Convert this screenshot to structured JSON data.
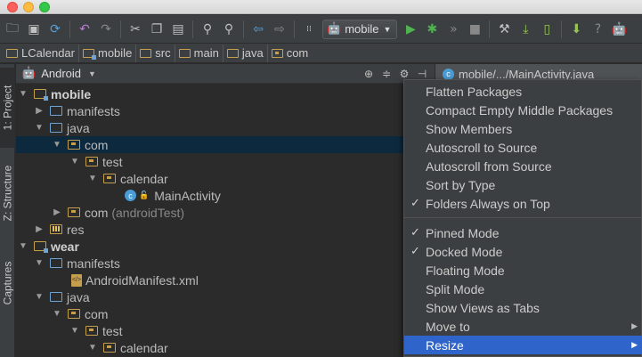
{
  "window": {
    "controls": [
      "close",
      "minimize",
      "zoom"
    ]
  },
  "toolbar": {
    "run_config": "mobile",
    "icons": [
      "open-folder-icon",
      "save-icon",
      "sync-icon",
      "undo-icon",
      "redo-icon",
      "cut-icon",
      "copy-icon",
      "paste-icon",
      "find-icon",
      "replace-icon",
      "back-icon",
      "forward-icon",
      "build-icon",
      "run-icon",
      "debug-icon",
      "attach-debugger-icon",
      "stop-icon",
      "project-structure-icon",
      "sdk-manager-icon",
      "avd-manager-icon",
      "android-monitor-icon",
      "android-icon"
    ]
  },
  "breadcrumb": [
    "LCalendar",
    "mobile",
    "src",
    "main",
    "java",
    "com"
  ],
  "left_strip": {
    "project": "1: Project",
    "structure": "Z: Structure",
    "captures": "Captures"
  },
  "project_panel": {
    "view": "Android"
  },
  "editor_tab": {
    "label": "mobile/.../MainActivity.java",
    "icon": "class-icon"
  },
  "tree": [
    {
      "label": "mobile",
      "depth": 0,
      "arrow": "▼",
      "icon": "module",
      "bold": true
    },
    {
      "label": "manifests",
      "depth": 1,
      "arrow": "▶",
      "icon": "folder-blue"
    },
    {
      "label": "java",
      "depth": 1,
      "arrow": "▼",
      "icon": "folder-blue"
    },
    {
      "label": "com",
      "depth": 2,
      "arrow": "▼",
      "icon": "package",
      "selected": true
    },
    {
      "label": "test",
      "depth": 3,
      "arrow": "▼",
      "icon": "package"
    },
    {
      "label": "calendar",
      "depth": 4,
      "arrow": "▼",
      "icon": "package"
    },
    {
      "label": "MainActivity",
      "depth": 5,
      "arrow": "",
      "icon": "class"
    },
    {
      "label": "com",
      "suffix": "(androidTest)",
      "depth": 2,
      "arrow": "▶",
      "icon": "package"
    },
    {
      "label": "res",
      "depth": 1,
      "arrow": "▶",
      "icon": "res"
    },
    {
      "label": "wear",
      "depth": 0,
      "arrow": "▼",
      "icon": "module",
      "bold": true
    },
    {
      "label": "manifests",
      "depth": 1,
      "arrow": "▼",
      "icon": "folder-blue"
    },
    {
      "label": "AndroidManifest.xml",
      "depth": 2,
      "arrow": "",
      "icon": "xml"
    },
    {
      "label": "java",
      "depth": 1,
      "arrow": "▼",
      "icon": "folder-blue"
    },
    {
      "label": "com",
      "depth": 2,
      "arrow": "▼",
      "icon": "package"
    },
    {
      "label": "test",
      "depth": 3,
      "arrow": "▼",
      "icon": "package"
    },
    {
      "label": "calendar",
      "depth": 4,
      "arrow": "▼",
      "icon": "package"
    }
  ],
  "menu": {
    "group1": [
      {
        "label": "Flatten Packages",
        "checked": false
      },
      {
        "label": "Compact Empty Middle Packages",
        "checked": false
      },
      {
        "label": "Show Members",
        "checked": false
      },
      {
        "label": "Autoscroll to Source",
        "checked": false
      },
      {
        "label": "Autoscroll from Source",
        "checked": false
      },
      {
        "label": "Sort by Type",
        "checked": false
      },
      {
        "label": "Folders Always on Top",
        "checked": true
      }
    ],
    "group2": [
      {
        "label": "Pinned Mode",
        "checked": true
      },
      {
        "label": "Docked Mode",
        "checked": true
      },
      {
        "label": "Floating Mode",
        "checked": false
      },
      {
        "label": "Split Mode",
        "checked": false
      },
      {
        "label": "Show Views as Tabs",
        "checked": false
      },
      {
        "label": "Move to",
        "checked": false,
        "submenu": true
      },
      {
        "label": "Resize",
        "checked": false,
        "submenu": true,
        "highlighted": true
      }
    ]
  },
  "colors": {
    "selection": "#0d293e",
    "menu_highlight": "#2f65ca",
    "folder": "#c69f4c",
    "source_folder": "#6ea3d5",
    "android": "#97c35b"
  }
}
